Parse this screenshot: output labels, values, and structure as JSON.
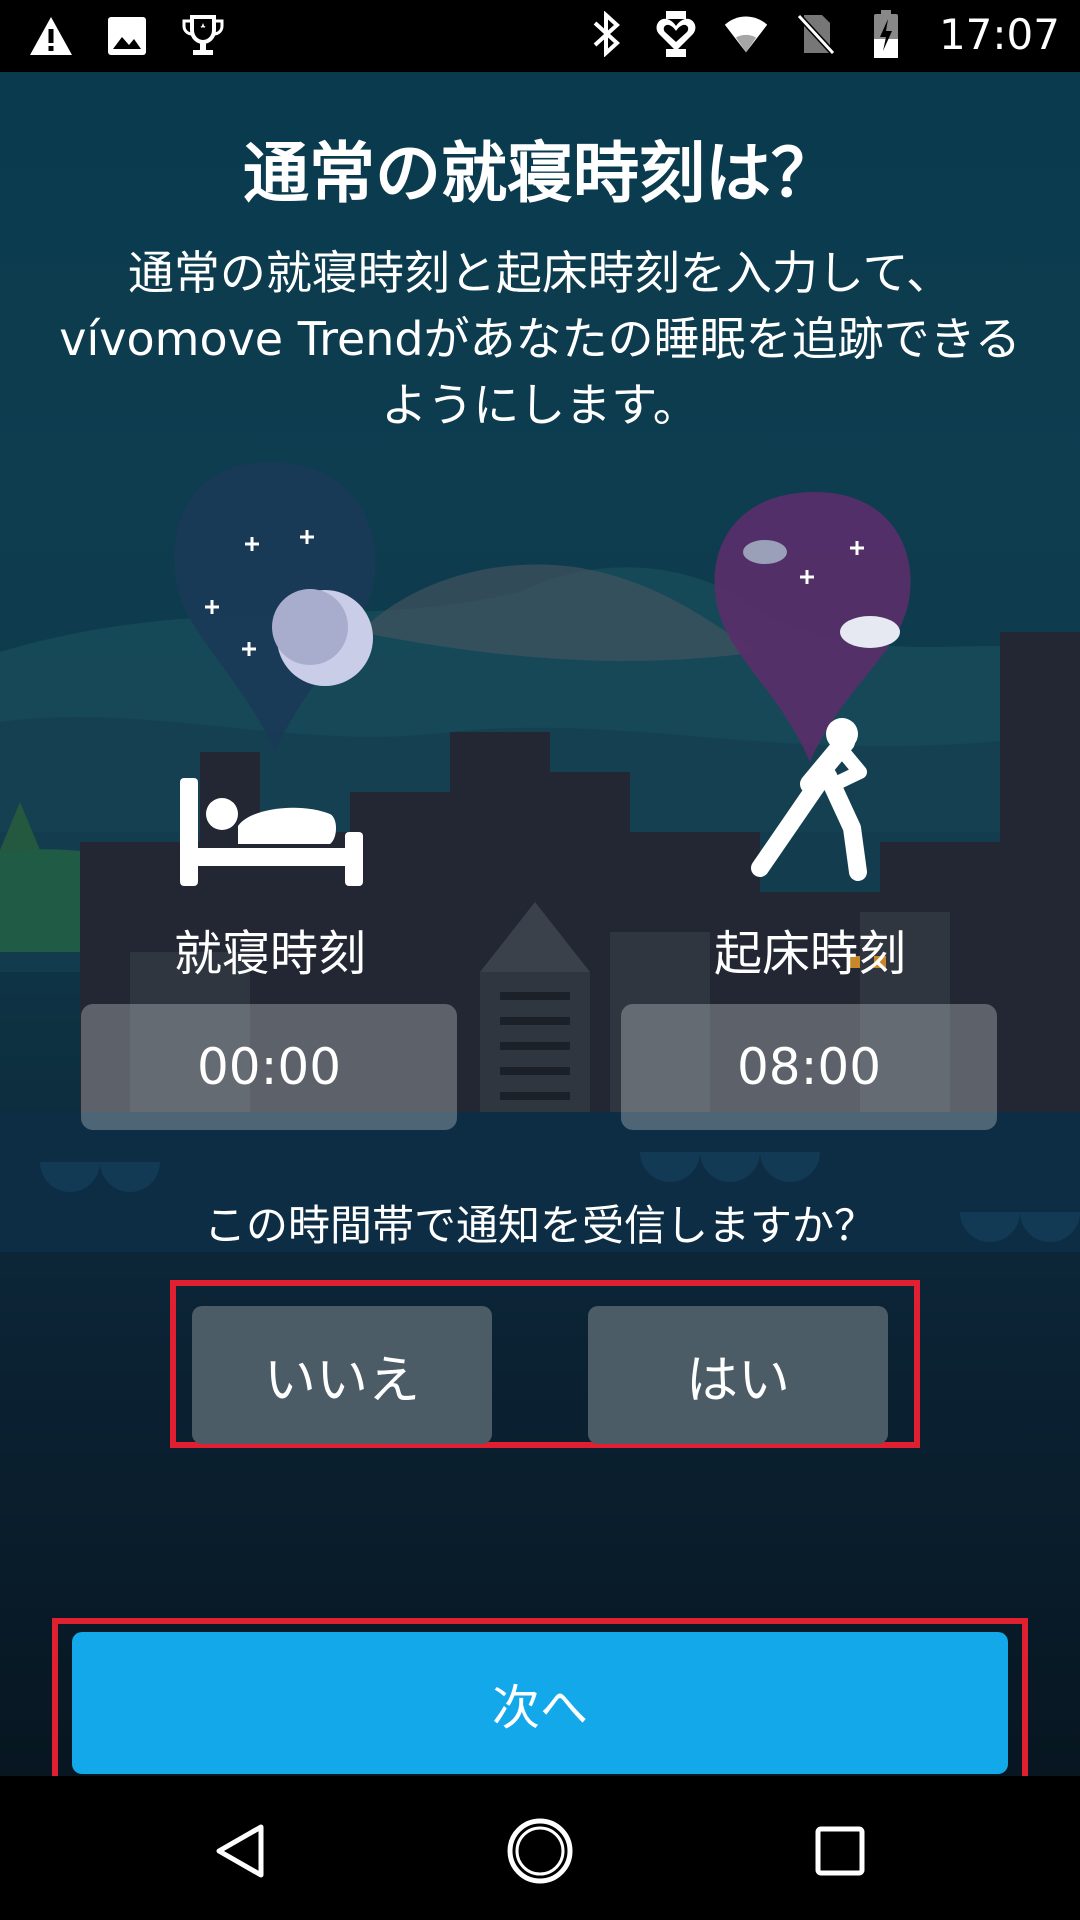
{
  "status_bar": {
    "time": "17:07",
    "left_icons": [
      "warning-icon",
      "image-icon",
      "trophy-icon"
    ],
    "right_icons": [
      "bluetooth-icon",
      "heart-watch-icon",
      "wifi-icon",
      "no-sim-icon",
      "battery-charging-icon"
    ]
  },
  "screen": {
    "title": "通常の就寝時刻は？",
    "description": "通常の就寝時刻と起床時刻を入力して、vívomove Trendがあなたの睡眠を追跡できるようにします。",
    "bedtime": {
      "label": "就寝時刻",
      "value": "00:00",
      "icon": "bed-icon"
    },
    "wake_time": {
      "label": "起床時刻",
      "value": "08:00",
      "icon": "stretch-icon"
    },
    "notification_question": "この時間帯で通知を受信しますか？",
    "no_button": "いいえ",
    "yes_button": "はい",
    "next_button": "次へ"
  },
  "nav_bar": {
    "icons": [
      "back-icon",
      "home-icon",
      "recents-icon"
    ]
  },
  "colors": {
    "accent": "#12a8ea",
    "choice_button": "#4b5c66",
    "highlight_frame": "#e02030"
  }
}
